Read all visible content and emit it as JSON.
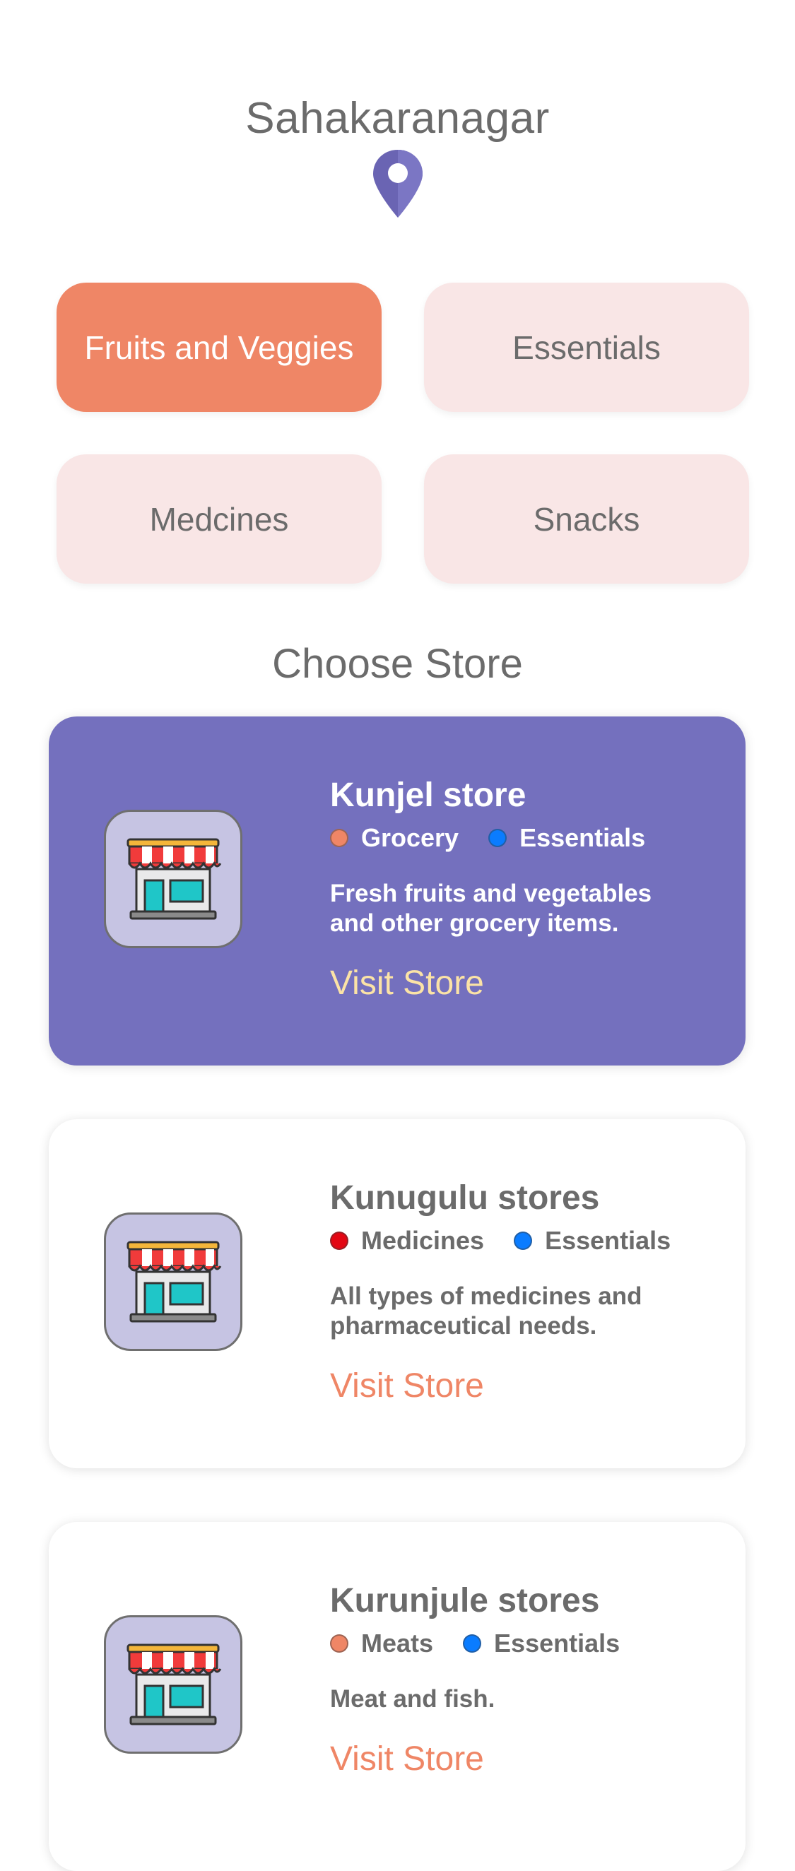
{
  "location": {
    "name": "Sahakaranagar",
    "pin_color": "#6a64b3"
  },
  "categories": [
    {
      "label": "Fruits and Veggies",
      "active": true
    },
    {
      "label": "Essentials",
      "active": false
    },
    {
      "label": "Medcines",
      "active": false
    },
    {
      "label": "Snacks",
      "active": false
    }
  ],
  "section_title": "Choose Store",
  "colors": {
    "accent": "#ef8666",
    "primary": "#7470be",
    "category_bg": "#f9e6e6",
    "visit_active": "#fbe3a6"
  },
  "stores": [
    {
      "name": "Kunjel store",
      "active": true,
      "tags": [
        {
          "label": "Grocery",
          "color": "#ef8666"
        },
        {
          "label": "Essentials",
          "color": "#0a7cff"
        }
      ],
      "description_line1": "Fresh fruits and vegetables",
      "description_line2": "and other grocery items.",
      "action": "Visit Store",
      "icon": "storefront-icon"
    },
    {
      "name": "Kunugulu stores",
      "active": false,
      "tags": [
        {
          "label": "Medicines",
          "color": "#e30613"
        },
        {
          "label": "Essentials",
          "color": "#0a7cff"
        }
      ],
      "description_line1": "All types of medicines and",
      "description_line2": "pharmaceutical needs.",
      "action": "Visit Store",
      "icon": "storefront-icon"
    },
    {
      "name": "Kurunjule stores",
      "active": false,
      "tags": [
        {
          "label": "Meats",
          "color": "#ef8666"
        },
        {
          "label": "Essentials",
          "color": "#0a7cff"
        }
      ],
      "description_line1": "Meat and fish.",
      "description_line2": "",
      "action": "Visit Store",
      "icon": "storefront-icon"
    }
  ]
}
